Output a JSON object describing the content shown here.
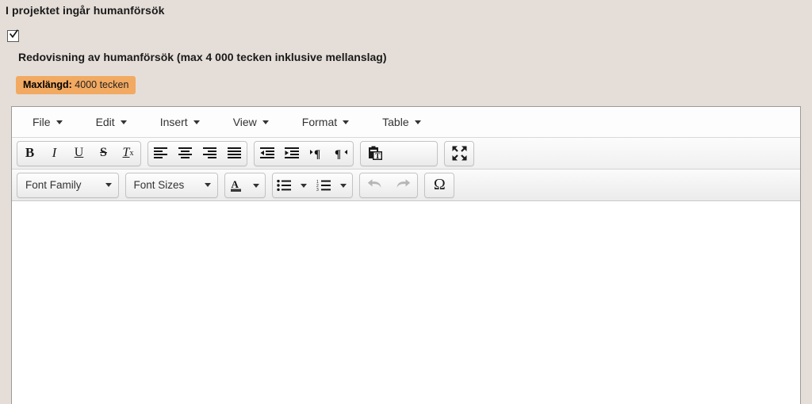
{
  "form": {
    "section_title": "I projektet ingår humanförsök",
    "checkbox_checked": true,
    "checkbox_icon": "checkmark-icon",
    "sub_title": "Redovisning av humanförsök (max 4 000 tecken inklusive mellanslag)",
    "max_length_label": "Maxlängd:",
    "max_length_value": "4000 tecken"
  },
  "editor": {
    "menubar": [
      {
        "label": "File",
        "name": "menu-file"
      },
      {
        "label": "Edit",
        "name": "menu-edit"
      },
      {
        "label": "Insert",
        "name": "menu-insert"
      },
      {
        "label": "View",
        "name": "menu-view"
      },
      {
        "label": "Format",
        "name": "menu-format"
      },
      {
        "label": "Table",
        "name": "menu-table"
      }
    ],
    "toolbar_row1": {
      "group1": [
        {
          "icon": "bold-icon",
          "glyph": "B"
        },
        {
          "icon": "italic-icon",
          "glyph": "I"
        },
        {
          "icon": "underline-icon",
          "glyph": "U"
        },
        {
          "icon": "strikethrough-icon",
          "glyph": "S"
        },
        {
          "icon": "remove-format-icon",
          "glyph": "Tx"
        }
      ],
      "group2": [
        {
          "icon": "align-left-icon"
        },
        {
          "icon": "align-center-icon"
        },
        {
          "icon": "align-right-icon"
        },
        {
          "icon": "align-justify-icon"
        }
      ],
      "group3": [
        {
          "icon": "outdent-icon"
        },
        {
          "icon": "indent-icon"
        },
        {
          "icon": "ltr-icon"
        },
        {
          "icon": "rtl-icon"
        }
      ],
      "group4": [
        {
          "icon": "paste-as-text-icon"
        }
      ],
      "group5": [
        {
          "icon": "fullscreen-icon"
        }
      ]
    },
    "toolbar_row2": {
      "font_family_label": "Font Family",
      "font_sizes_label": "Font Sizes",
      "forecolor_icon": "text-color-icon",
      "bullist_icon": "bullet-list-icon",
      "numlist_icon": "numbered-list-icon",
      "undo_icon": "undo-icon",
      "redo_icon": "redo-icon",
      "charmap_icon": "special-character-icon",
      "charmap_glyph": "Ω"
    },
    "content_text": ""
  },
  "colors": {
    "page_background": "#e5ded8",
    "badge_orange": "#f2a961",
    "editor_border": "#9a9a9a",
    "toolbar_text": "#333333"
  }
}
